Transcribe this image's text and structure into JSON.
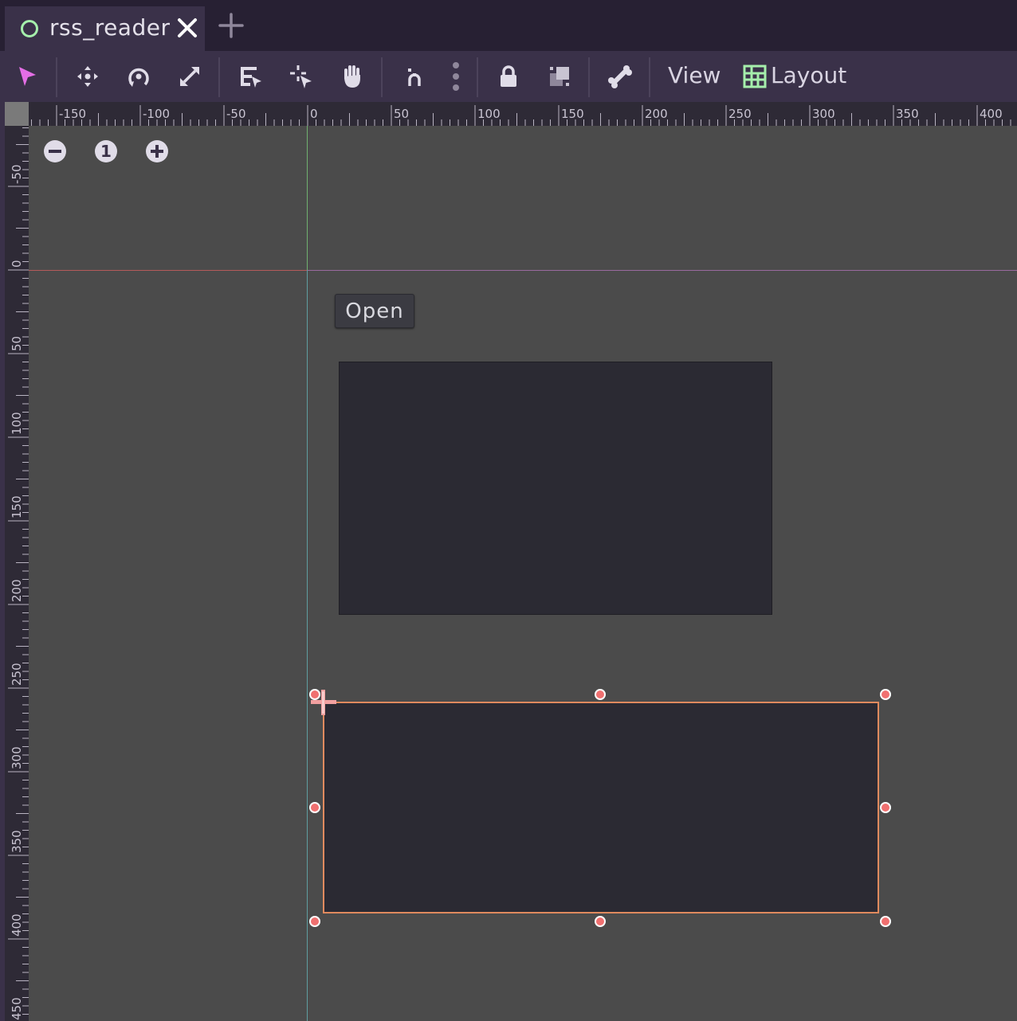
{
  "tabs": {
    "active_label": "rss_reader",
    "close_icon": "close-icon",
    "add_icon": "plus-icon"
  },
  "toolbar": {
    "view_label": "View",
    "layout_label": "Layout"
  },
  "ruler": {
    "top_labels": [
      "-150",
      "-100",
      "-50",
      "0",
      "50",
      "100",
      "150",
      "200",
      "250",
      "300",
      "350",
      "400"
    ],
    "left_labels": [
      "-50",
      "0",
      "50",
      "100",
      "150",
      "200",
      "250",
      "300",
      "350",
      "400",
      "450"
    ]
  },
  "zoom": {
    "reset_label": "1"
  },
  "canvas": {
    "open_button_label": "Open"
  },
  "colors": {
    "accent_selection": "#e08a5e",
    "handle": "#f07070",
    "origin_x_axis": "#b55a5a",
    "origin_y_axis": "#6fb06f"
  }
}
